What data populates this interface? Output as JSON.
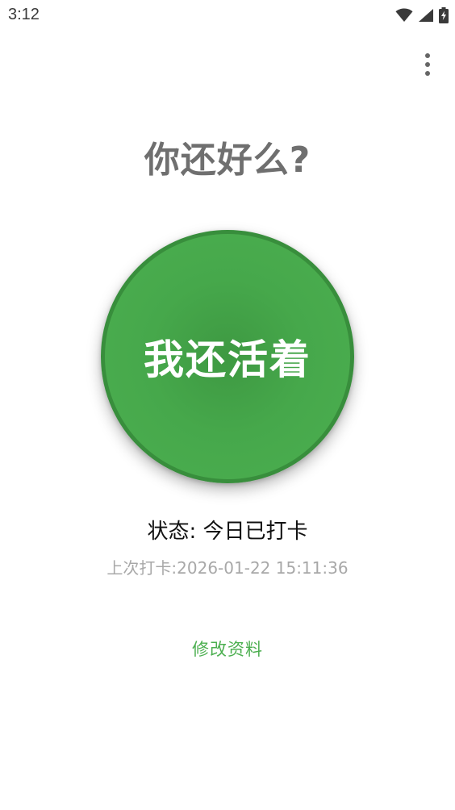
{
  "status_bar": {
    "time": "3:12",
    "icons": [
      "wifi-icon",
      "cellular-signal-icon",
      "battery-charging-icon"
    ]
  },
  "app_bar": {
    "overflow_icon": "more-vert-icon"
  },
  "main": {
    "title": "你还好么?",
    "checkin_button_label": "我还活着",
    "status_text": "状态: 今日已打卡",
    "last_checkin_text": "上次打卡:2026-01-22 15:11:36",
    "edit_profile_label": "修改资料"
  },
  "colors": {
    "accent_green": "#4caf50",
    "button_border": "#388e3c",
    "title_gray": "#6f6f6f",
    "secondary_gray": "#a8a8a8"
  }
}
